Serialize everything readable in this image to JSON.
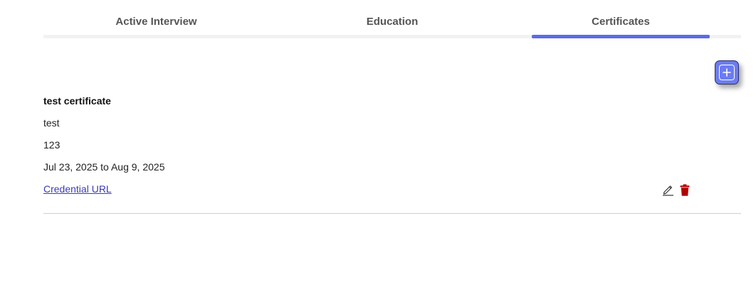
{
  "tabs": {
    "items": [
      {
        "label": "Active Interview"
      },
      {
        "label": "Education"
      },
      {
        "label": "Certificates"
      }
    ],
    "active": "Certificates",
    "accent_color": "#5b6be8"
  },
  "toolbar": {
    "add_icon": "plus-icon"
  },
  "certificate": {
    "name": "test certificate",
    "organization": "test",
    "credential_id": "123",
    "dates": "Jul 23, 2025 to Aug 9, 2025",
    "link_label": "Credential URL",
    "edit_icon": "pencil-icon",
    "delete_icon": "trash-icon",
    "delete_color": "#b30000"
  }
}
